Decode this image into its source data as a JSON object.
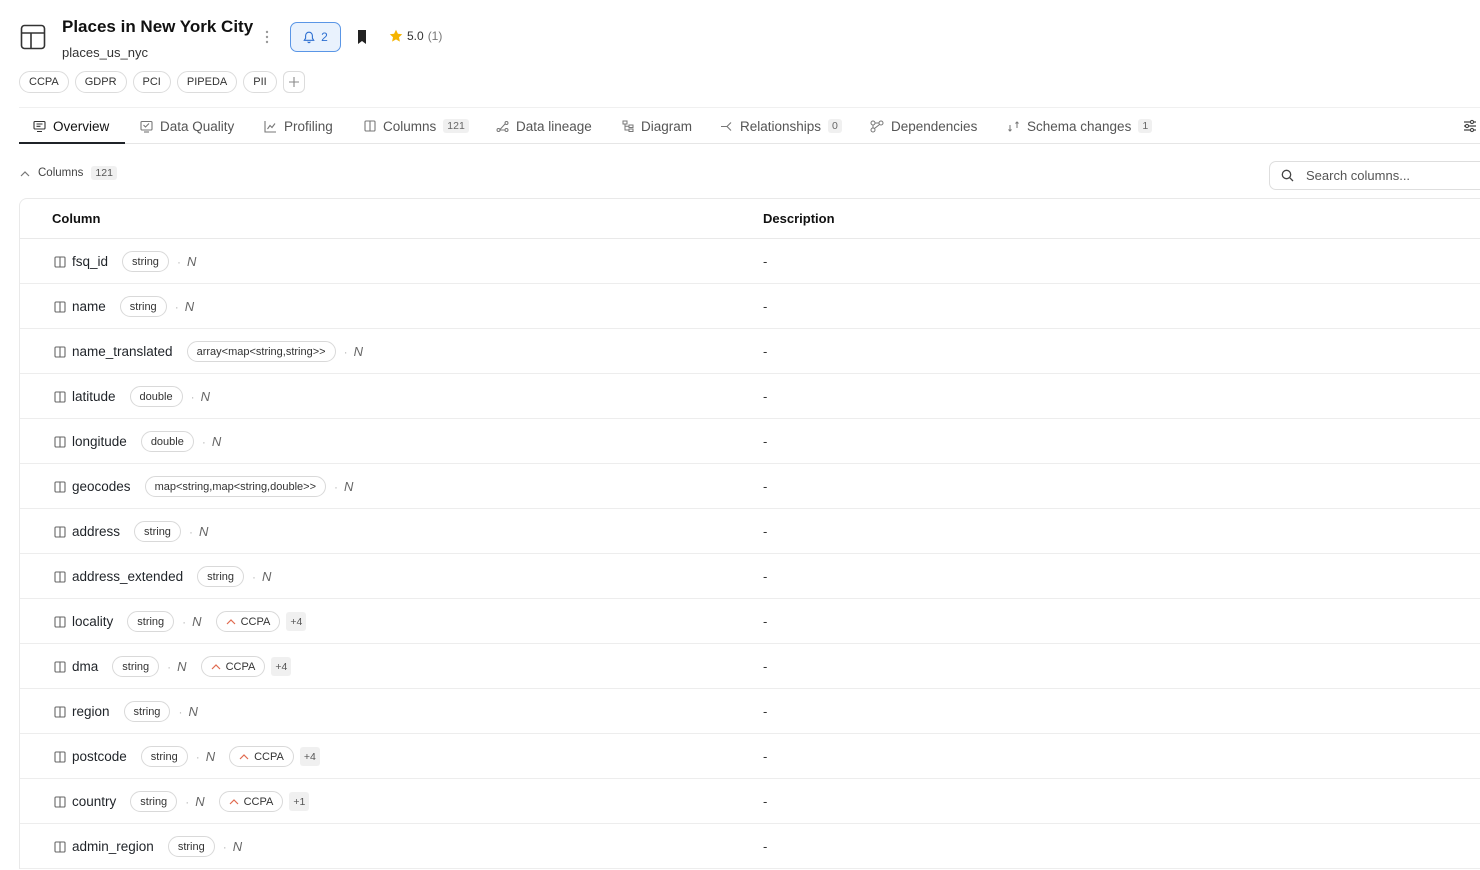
{
  "header": {
    "title": "Places in New York City",
    "subtitle": "places_us_nyc",
    "bell_count": "2",
    "rating": "5.0",
    "rating_count": "(1)"
  },
  "tags": [
    "CCPA",
    "GDPR",
    "PCI",
    "PIPEDA",
    "PII"
  ],
  "tabs": [
    {
      "label": "Overview",
      "icon": "overview-icon",
      "badge": ""
    },
    {
      "label": "Data Quality",
      "icon": "data-quality-icon",
      "badge": ""
    },
    {
      "label": "Profiling",
      "icon": "profiling-icon",
      "badge": ""
    },
    {
      "label": "Columns",
      "icon": "columns-icon",
      "badge": "121"
    },
    {
      "label": "Data lineage",
      "icon": "lineage-icon",
      "badge": ""
    },
    {
      "label": "Diagram",
      "icon": "diagram-icon",
      "badge": ""
    },
    {
      "label": "Relationships",
      "icon": "relationships-icon",
      "badge": "0"
    },
    {
      "label": "Dependencies",
      "icon": "dependencies-icon",
      "badge": ""
    },
    {
      "label": "Schema changes",
      "icon": "schema-changes-icon",
      "badge": "1"
    }
  ],
  "section": {
    "label": "Columns",
    "count": "121"
  },
  "search": {
    "placeholder": "Search columns..."
  },
  "table": {
    "headers": {
      "column": "Column",
      "description": "Description"
    },
    "nullable_marker": "N",
    "rows": [
      {
        "name": "fsq_id",
        "type": "string",
        "tag": "",
        "more": "",
        "description": "-"
      },
      {
        "name": "name",
        "type": "string",
        "tag": "",
        "more": "",
        "description": "-"
      },
      {
        "name": "name_translated",
        "type": "array<map<string,string>>",
        "tag": "",
        "more": "",
        "description": "-"
      },
      {
        "name": "latitude",
        "type": "double",
        "tag": "",
        "more": "",
        "description": "-"
      },
      {
        "name": "longitude",
        "type": "double",
        "tag": "",
        "more": "",
        "description": "-"
      },
      {
        "name": "geocodes",
        "type": "map<string,map<string,double>>",
        "tag": "",
        "more": "",
        "description": "-"
      },
      {
        "name": "address",
        "type": "string",
        "tag": "",
        "more": "",
        "description": "-"
      },
      {
        "name": "address_extended",
        "type": "string",
        "tag": "",
        "more": "",
        "description": "-"
      },
      {
        "name": "locality",
        "type": "string",
        "tag": "CCPA",
        "more": "+4",
        "description": "-"
      },
      {
        "name": "dma",
        "type": "string",
        "tag": "CCPA",
        "more": "+4",
        "description": "-"
      },
      {
        "name": "region",
        "type": "string",
        "tag": "",
        "more": "",
        "description": "-"
      },
      {
        "name": "postcode",
        "type": "string",
        "tag": "CCPA",
        "more": "+4",
        "description": "-"
      },
      {
        "name": "country",
        "type": "string",
        "tag": "CCPA",
        "more": "+1",
        "description": "-"
      },
      {
        "name": "admin_region",
        "type": "string",
        "tag": "",
        "more": "",
        "description": "-"
      }
    ]
  },
  "colors": {
    "accent": "#2c6fd1",
    "star": "#f5b400",
    "tag_chevron": "#e06a4f"
  }
}
